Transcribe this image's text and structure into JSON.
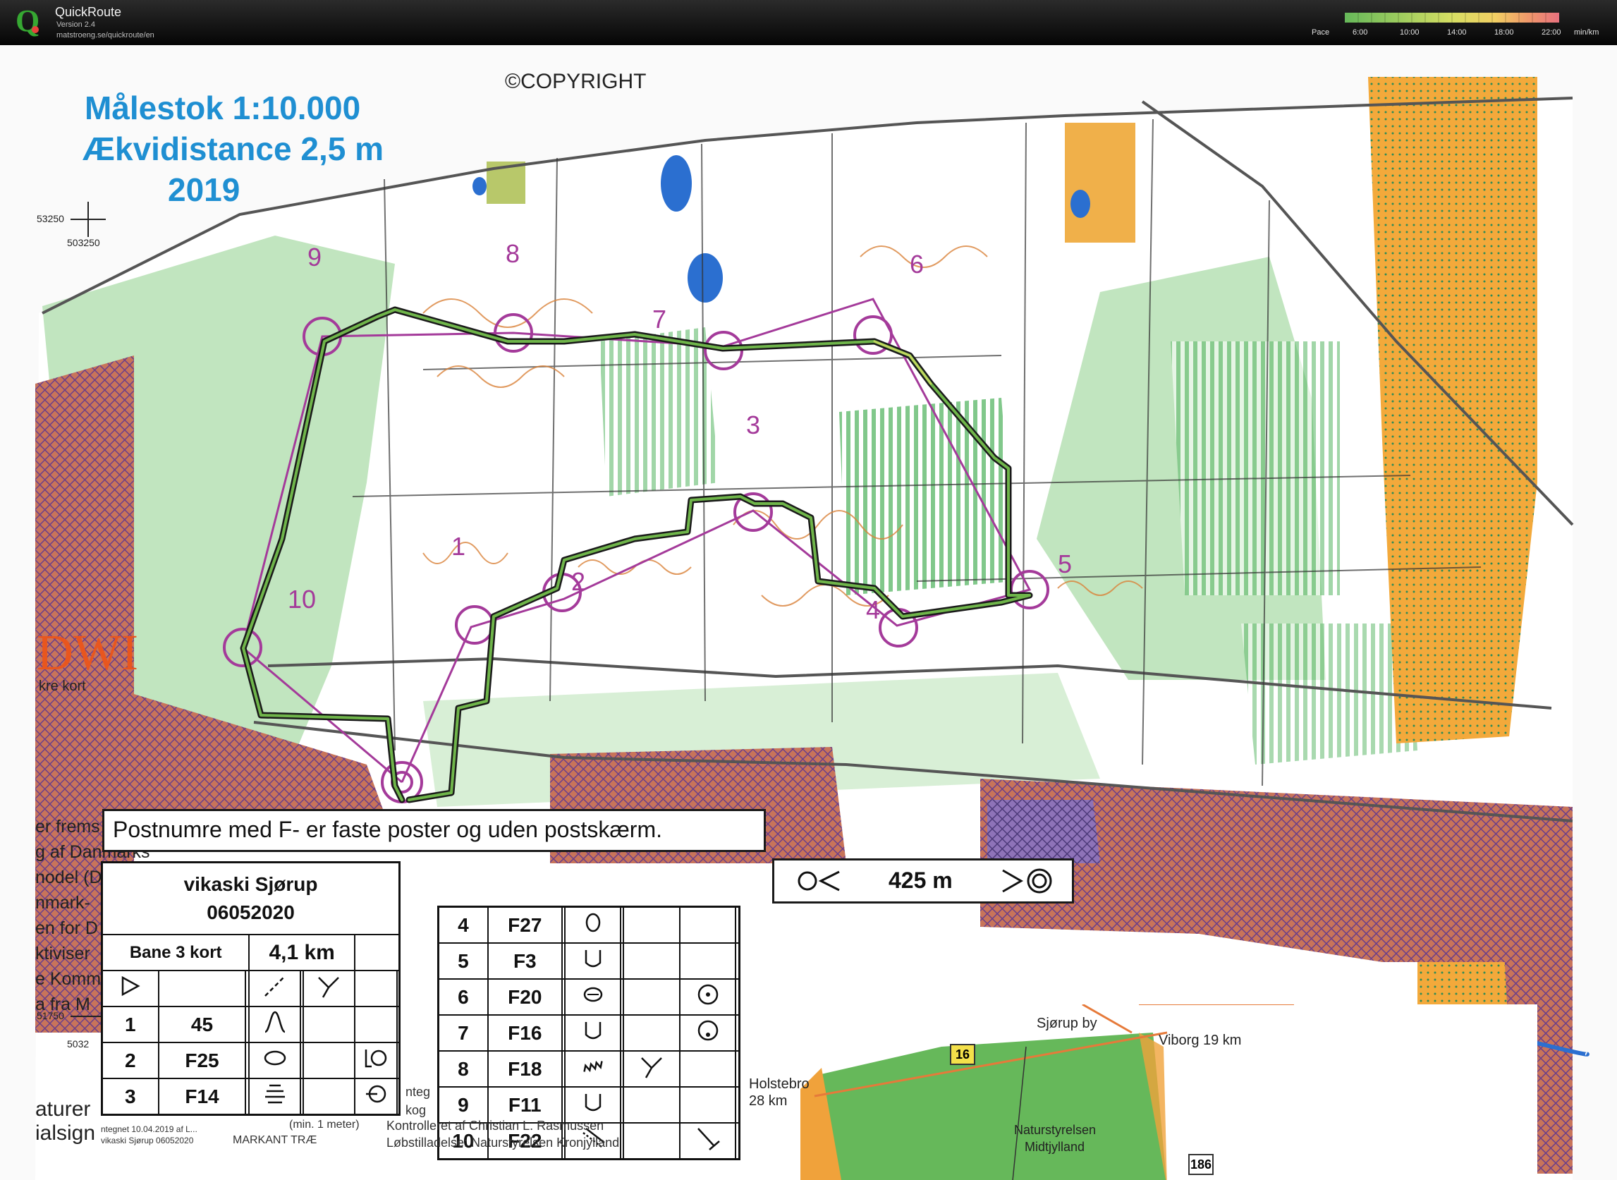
{
  "app": {
    "name": "QuickRoute",
    "version": "Version 2.4",
    "url": "matstroeng.se/quickroute/en"
  },
  "pace_scale": {
    "label": "Pace",
    "ticks": [
      "6:00",
      "10:00",
      "14:00",
      "18:00",
      "22:00"
    ],
    "unit": "min/km",
    "colors": [
      "#66b85a",
      "#9ccc5e",
      "#d6de63",
      "#f2cf63",
      "#f09a6a",
      "#e8717e"
    ]
  },
  "map": {
    "scale": "Målestok 1:10.000",
    "contour_interval": "Ækvidistance 2,5 m",
    "year": "2019",
    "copyright": "©COPYRIGHT",
    "coord_top_left": "503250",
    "coord_top_left_cut": "53250",
    "coord_bottom_left": "51750",
    "coord_bottom_left2": "5032",
    "edge_logo": "DWI",
    "edge_lines": [
      "kre kort",
      "er frems",
      "g af Danmarks",
      "nodel (D",
      "nmark-",
      "en for D",
      "ktiviser",
      "e Komm",
      "a fra M",
      "aturer",
      "ialsign"
    ],
    "bottom_lines": [
      "ntegnet 10.04.2019 af L...",
      "vikaski Sjørup 06052020",
      "MARKANT TRÆ",
      "(min. 1 meter)",
      "Kontrolleret af Christian L. Rasmussen",
      "Løbstilladelse: Naturstyrelsen Kronjylland",
      "nteg",
      "kog"
    ]
  },
  "controls": [
    "1",
    "2",
    "3",
    "4",
    "5",
    "6",
    "7",
    "8",
    "9",
    "10"
  ],
  "note": "Postnumre med F- er faste poster og uden postskærm.",
  "leg_distance": "425 m",
  "course": {
    "event": "vikaski Sjørup",
    "date": "06052020",
    "course_name": "Bane 3 kort",
    "length": "4,1 km"
  },
  "control_descriptions": [
    {
      "num": "1",
      "code": "45"
    },
    {
      "num": "2",
      "code": "F25"
    },
    {
      "num": "3",
      "code": "F14"
    },
    {
      "num": "4",
      "code": "F27"
    },
    {
      "num": "5",
      "code": "F3"
    },
    {
      "num": "6",
      "code": "F20"
    },
    {
      "num": "7",
      "code": "F16"
    },
    {
      "num": "8",
      "code": "F18"
    },
    {
      "num": "9",
      "code": "F11"
    },
    {
      "num": "10",
      "code": "F22"
    }
  ],
  "location_map": {
    "town": "Sjørup by",
    "viborg": "Viborg 19 km",
    "holstebro": "Holstebro",
    "holstebro_dist": "28 km",
    "forest": "Naturstyrelsen",
    "forest2": "Midtjylland",
    "road_16": "16",
    "road_186": "186"
  }
}
